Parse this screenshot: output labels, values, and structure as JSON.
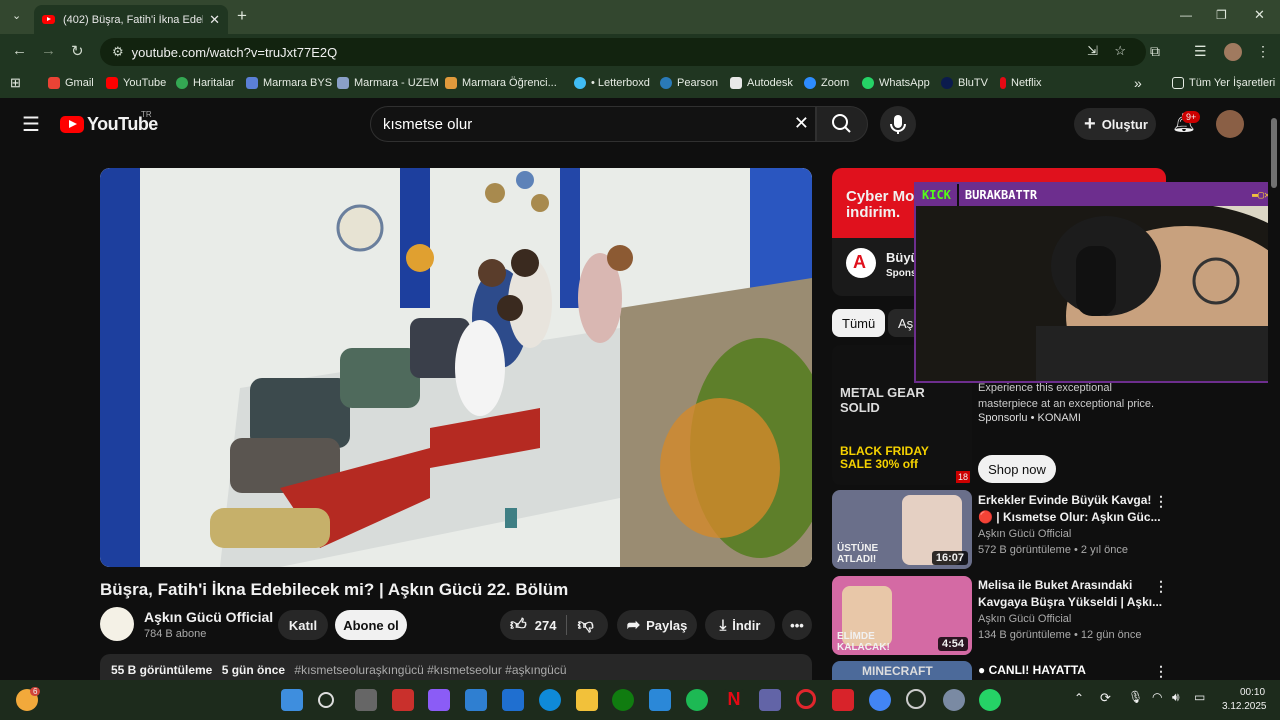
{
  "browser": {
    "tab_title": "(402) Büşra, Fatih'i İkna Edebilecek mi? | Aşkın Gücü 22. Bölüm",
    "url": "youtube.com/watch?v=truJxt77E2Q",
    "new_tab": "+",
    "bookmarks": [
      "Gmail",
      "YouTube",
      "Haritalar",
      "Marmara BYS",
      "Marmara - UZEM",
      "Marmara Öğrenci...",
      "• Letterboxd",
      "Pearson",
      "Autodesk",
      "Zoom",
      "WhatsApp",
      "BluTV",
      "Netflix"
    ],
    "all_bookmarks": "Tüm Yer İşaretleri",
    "more": "»"
  },
  "yt": {
    "logo": "YouTube",
    "region": "TR",
    "search_value": "kısmetse olur",
    "create": "Oluştur",
    "notif_count": "9+"
  },
  "video": {
    "title": "Büşra, Fatih'i İkna Edebilecek mi? | Aşkın Gücü 22. Bölüm",
    "channel": "Aşkın Gücü Official",
    "subs": "784 B abone",
    "join": "Katıl",
    "subscribe": "Abone ol",
    "likes": "274",
    "share": "Paylaş",
    "download": "İndir",
    "views": "55 B görüntüleme",
    "age": "5 gün önce",
    "tags": "#kısmetseoluraşkıngücü #kısmetseolur #aşkıngücü"
  },
  "ad": {
    "headline": "Cyber Mo",
    "headline2": "indirim.",
    "brand": "Büyü",
    "sponsor": "Spons"
  },
  "kick": {
    "logo": "KICK",
    "name": "BURAKBATTR"
  },
  "chips": [
    "Tümü",
    "Aş"
  ],
  "recs": [
    {
      "title1": "Experience this exceptional",
      "title2": "masterpiece at an exceptional price.",
      "meta": "Sponsorlu • KONAMI",
      "cta": "Shop now",
      "badge": "18",
      "thumb_text": "METAL GEAR SOLID",
      "sale": "BLACK FRIDAY SALE 30% off"
    },
    {
      "title1": "Erkekler Evinde Büyük Kavga!",
      "title2": "🔴 | Kısmetse Olur: Aşkın Güc...",
      "channel": "Aşkın Gücü Official",
      "meta": "572 B görüntüleme • 2 yıl önce",
      "duration": "16:07",
      "overlay": "ÜSTÜNE ATLADI!"
    },
    {
      "title1": "Melisa ile Buket Arasındaki",
      "title2": "Kavgaya Büşra Yükseldi | Aşkı...",
      "channel": "Aşkın Gücü Official",
      "meta": "134 B görüntüleme • 12 gün önce",
      "duration": "4:54",
      "overlay": "ELİMDE KALACAK!"
    },
    {
      "title1": "● CANLI! HAYATTA",
      "thumb_text": "MINECRAFT"
    }
  ],
  "taskbar": {
    "time": "00:10",
    "date": "3.12.2025",
    "badge": "6"
  },
  "colors": {
    "accent": "#ff0000",
    "kick": "#53fc18",
    "frame": "#6d2e8e"
  }
}
